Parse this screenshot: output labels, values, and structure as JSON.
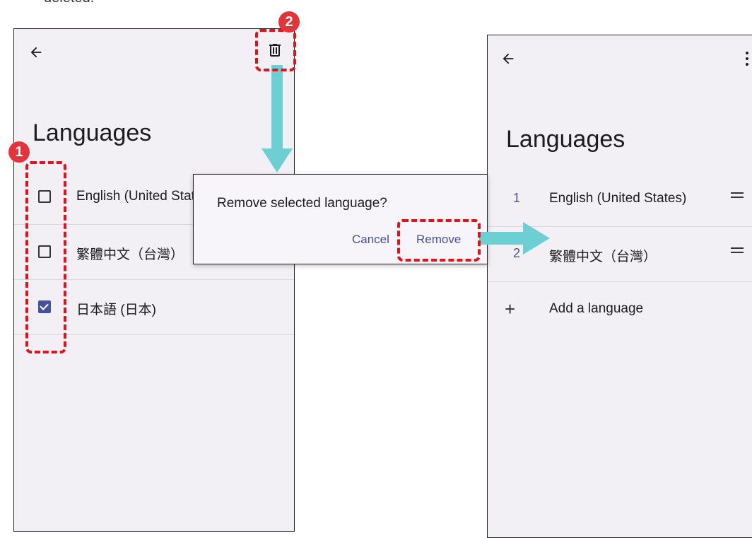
{
  "caption": "deleted.",
  "left_screen": {
    "title": "Languages",
    "items": [
      {
        "label": "English (United States)",
        "checked": false
      },
      {
        "label": "繁體中文（台灣）",
        "checked": false
      },
      {
        "label": "日本語 (日本)",
        "checked": true
      }
    ],
    "icons": [
      "back-arrow-icon",
      "trash-icon",
      "checkbox-icon"
    ]
  },
  "dialog": {
    "title": "Remove selected language?",
    "cancel_label": "Cancel",
    "remove_label": "Remove"
  },
  "right_screen": {
    "title": "Languages",
    "items": [
      {
        "number": "1",
        "label": "English (United States)"
      },
      {
        "number": "2",
        "label": "繁體中文（台灣）"
      }
    ],
    "add_label": "Add a language",
    "icons": [
      "back-arrow-icon",
      "more-vert-icon",
      "drag-handle-icon",
      "plus-icon"
    ]
  },
  "annotations": {
    "step1": "1",
    "step2": "2",
    "highlight_color": "#e3121a",
    "arrow_color": "#6ccfd3"
  }
}
